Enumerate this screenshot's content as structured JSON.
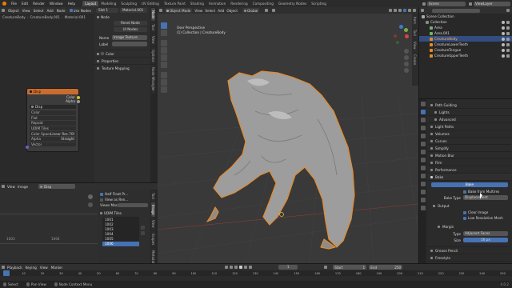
{
  "topbar": {
    "menus": [
      "File",
      "Edit",
      "Render",
      "Window",
      "Help"
    ],
    "workspaces": [
      "Layout",
      "Modeling",
      "Sculpting",
      "UV Editing",
      "Texture Paint",
      "Shading",
      "Animation",
      "Rendering",
      "Compositing",
      "Geometry Nodes",
      "Scripting"
    ],
    "active_workspace": "Layout",
    "scene": "Scene",
    "view_layer": "ViewLayer"
  },
  "node_editor": {
    "header": [
      "Object",
      "View",
      "Select",
      "Add",
      "Node"
    ],
    "use_nodes": "Use Nodes",
    "slot": "Slot 1",
    "material": "Material.001",
    "breadcrumb": [
      "CreatureBody",
      "CreatureBody.001",
      "Material.001"
    ],
    "node": {
      "title": "Disp",
      "outputs": [
        "Color",
        "Alpha"
      ],
      "name_field": "Disp",
      "fields": [
        {
          "k": "Color",
          "v": ""
        },
        {
          "k": "Flat",
          "v": ""
        },
        {
          "k": "Repeat",
          "v": ""
        },
        {
          "k": "UDIM Tiles",
          "v": ""
        },
        {
          "k": "Color Space",
          "v": "Linear Rec.709"
        },
        {
          "k": "Alpha",
          "v": "Straight"
        },
        {
          "k": "Vector",
          "v": ""
        }
      ]
    }
  },
  "sidebar": {
    "tab_label": "Node",
    "reset_label": "Reset Node",
    "ui_nodes": "UI Nodes",
    "name_label": "Name",
    "name_value": "Image Texture",
    "label_label": "Label",
    "color_label": "Color",
    "sections": [
      "Properties",
      "Texture Mapping"
    ],
    "tabs": [
      "Node",
      "Tool",
      "View",
      "Options",
      "Node Wrangler"
    ]
  },
  "image_editor": {
    "header": [
      "View",
      "Image"
    ],
    "image_name": "Disp",
    "half_float": "Half Float Pr...",
    "view_as_render": "View as Ren...",
    "scale_label": "Views Mas...",
    "tile_numbers": [
      "1003",
      "1004"
    ],
    "udim": {
      "title": "UDIM Tiles",
      "tiles": [
        "1001",
        "1002",
        "1003",
        "1004",
        "1005",
        "1006"
      ],
      "selected": "1006"
    },
    "tabs": [
      "Tool",
      "Image",
      "View",
      "Scopes",
      "Metadata"
    ]
  },
  "viewport": {
    "mode": "Object Mode",
    "menus": [
      "View",
      "Select",
      "Add",
      "Object"
    ],
    "orientation": "Global",
    "options": "Options",
    "perspective": "User Perspective",
    "collection": "(1) Collection | CreatureBody",
    "tabs": [
      "Item",
      "Tool",
      "View",
      "Create"
    ]
  },
  "timeline": {
    "menus": [
      "Playback",
      "Keying",
      "View",
      "Marker"
    ],
    "start_label": "Start",
    "start_value": "1",
    "end_label": "End",
    "end_value": "250",
    "current_frame": "1",
    "ruler": [
      "0",
      "10",
      "20",
      "30",
      "40",
      "50",
      "60",
      "70",
      "80",
      "90",
      "100",
      "110",
      "120",
      "130",
      "140",
      "150",
      "160",
      "170",
      "180",
      "190",
      "200",
      "210",
      "220",
      "230",
      "240",
      "250"
    ]
  },
  "outliner": {
    "title": "Scene Collection",
    "items": [
      {
        "label": "Collection",
        "depth": 1,
        "icon": "collection"
      },
      {
        "label": "Area",
        "depth": 2,
        "icon": "light"
      },
      {
        "label": "Area.001",
        "depth": 2,
        "icon": "light"
      },
      {
        "label": "CreatureBody",
        "depth": 2,
        "icon": "mesh",
        "selected": true
      },
      {
        "label": "CreatureLowerTeeth",
        "depth": 2,
        "icon": "mesh"
      },
      {
        "label": "CreatureTongue",
        "depth": 2,
        "icon": "mesh"
      },
      {
        "label": "CreatureUpperTeeth",
        "depth": 2,
        "icon": "mesh"
      }
    ]
  },
  "properties": {
    "rows": [
      {
        "label": "Path Guiding",
        "type": "section"
      },
      {
        "label": "Lights",
        "type": "section"
      },
      {
        "label": "Advanced",
        "type": "section"
      },
      {
        "label": "Light Paths",
        "type": "section"
      },
      {
        "label": "Volumes",
        "type": "section"
      },
      {
        "label": "Curves",
        "type": "section"
      },
      {
        "label": "Simplify",
        "type": "section"
      },
      {
        "label": "Motion Blur",
        "type": "section"
      },
      {
        "label": "Film",
        "type": "section"
      },
      {
        "label": "Performance",
        "type": "section"
      },
      {
        "label": "Bake",
        "type": "section-open"
      }
    ],
    "bake_button": "Bake",
    "bake_multires": "Bake from Multires",
    "bake_type_label": "Bake Type",
    "bake_type_value": "Displacement",
    "output_label": "Output",
    "clear_image": "Clear Image",
    "low_res_mesh": "Low Resolution Mesh",
    "margin_label": "Margin",
    "type_label": "Type",
    "type_value": "Adjacent Faces",
    "size_label": "Size",
    "size_value": "16 px",
    "bottom_sections": [
      "Grease Pencil",
      "Freestyle",
      "Color Management"
    ]
  },
  "statusbar": {
    "items": [
      "Select",
      "Pan View",
      "Node Context Menu"
    ],
    "version": "4.0.2"
  },
  "colors": {
    "accent": "#4772b3",
    "selection_outline": "#e48a2c",
    "panel": "#303030",
    "background": "#1d1d1d"
  }
}
